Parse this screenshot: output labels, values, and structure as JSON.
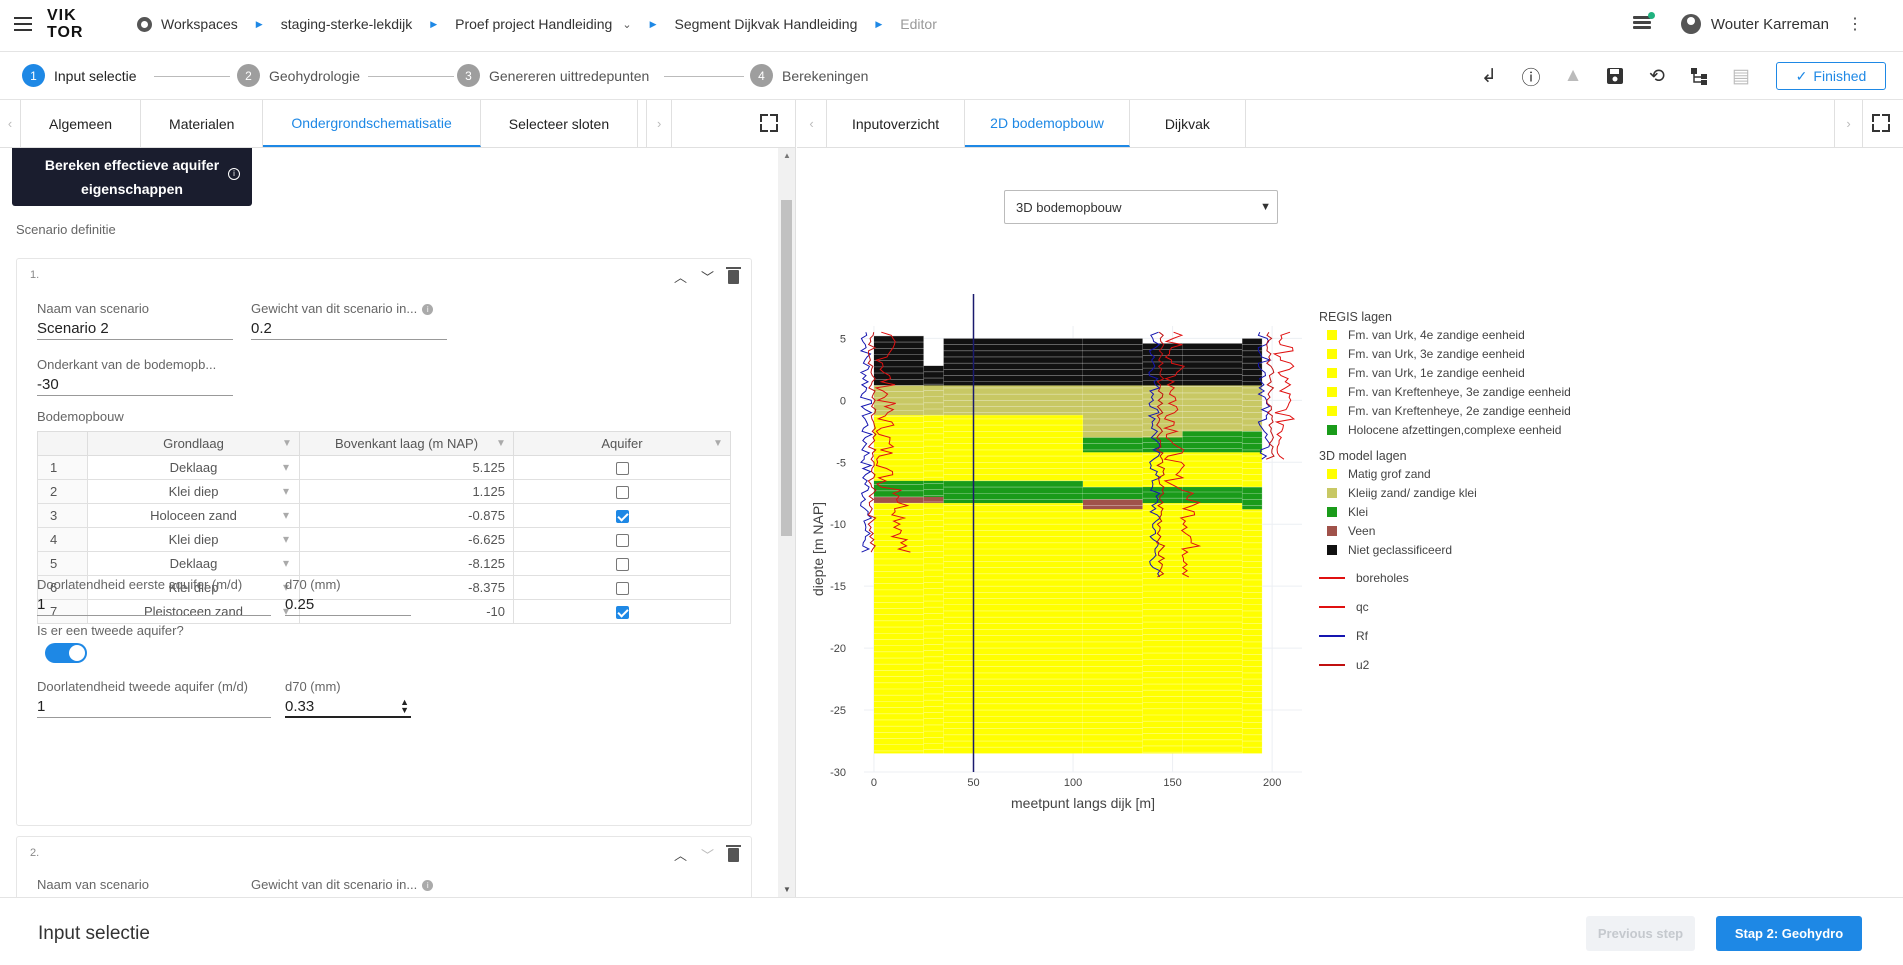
{
  "app": {
    "logo_top": "VIK",
    "logo_bottom": "TOR"
  },
  "breadcrumbs": [
    "Workspaces",
    "staging-sterke-lekdijk",
    "Proef project Handleiding",
    "Segment Dijkvak Handleiding",
    "Editor"
  ],
  "user": {
    "name": "Wouter Karreman"
  },
  "steps": [
    {
      "num": "1",
      "label": "Input selectie"
    },
    {
      "num": "2",
      "label": "Geohydrologie"
    },
    {
      "num": "3",
      "label": "Genereren uittredepunten"
    },
    {
      "num": "4",
      "label": "Berekeningen"
    }
  ],
  "toolbar": {
    "finished_label": "Finished"
  },
  "left_tabs": [
    "Algemeen",
    "Materialen",
    "Ondergrondschematisatie",
    "Selecteer sloten"
  ],
  "calc_button": {
    "line1": "Bereken effectieve aquifer",
    "line2": "eigenschappen"
  },
  "scenario_section": "Scenario definitie",
  "scenario1": {
    "num": "1.",
    "naam_label": "Naam van scenario",
    "naam_value": "Scenario 2",
    "gewicht_label": "Gewicht van dit scenario in...",
    "gewicht_value": "0.2",
    "onderkant_label": "Onderkant van de bodemopb...",
    "onderkant_value": "-30",
    "bodem_label": "Bodemopbouw",
    "table_headers": [
      "Grondlaag",
      "Bovenkant laag (m NAP)",
      "Aquifer"
    ],
    "rows": [
      {
        "idx": "1",
        "grondlaag": "Deklaag",
        "bovenkant": "5.125",
        "aquifer": false
      },
      {
        "idx": "2",
        "grondlaag": "Klei diep",
        "bovenkant": "1.125",
        "aquifer": false
      },
      {
        "idx": "3",
        "grondlaag": "Holoceen zand",
        "bovenkant": "-0.875",
        "aquifer": true
      },
      {
        "idx": "4",
        "grondlaag": "Klei diep",
        "bovenkant": "-6.625",
        "aquifer": false
      },
      {
        "idx": "5",
        "grondlaag": "Deklaag",
        "bovenkant": "-8.125",
        "aquifer": false
      },
      {
        "idx": "6",
        "grondlaag": "Klei diep",
        "bovenkant": "-8.375",
        "aquifer": false
      },
      {
        "idx": "7",
        "grondlaag": "Pleistoceen zand",
        "bovenkant": "-10",
        "aquifer": true
      }
    ],
    "doorl1_label": "Doorlatendheid eerste aquifer (m/d)",
    "doorl1_value": "1",
    "d70a_label": "d70 (mm)",
    "d70a_value": "0.25",
    "tweede_label": "Is er een tweede aquifer?",
    "tweede_value": true,
    "doorl2_label": "Doorlatendheid tweede aquifer (m/d)",
    "doorl2_value": "1",
    "d70b_label": "d70 (mm)",
    "d70b_value": "0.33"
  },
  "scenario2": {
    "num": "2.",
    "naam_label": "Naam van scenario",
    "gewicht_label": "Gewicht van dit scenario in..."
  },
  "right_tabs": [
    "Inputoverzicht",
    "2D bodemopbouw",
    "Dijkvak"
  ],
  "view_select": "3D bodemopbouw",
  "chart_data": {
    "type": "heatmap",
    "title": "",
    "xlabel": "meetpunt langs dijk [m]",
    "ylabel": "diepte [m NAP]",
    "xlim": [
      -5,
      215
    ],
    "ylim": [
      -30,
      6
    ],
    "xticks": [
      0,
      50,
      100,
      150,
      200
    ],
    "yticks": [
      5,
      0,
      -5,
      -10,
      -15,
      -20,
      -25,
      -30
    ],
    "vertical_marker_x": 50,
    "model_columns": [
      {
        "x0": 0,
        "x1": 25,
        "top": 5.2,
        "layers": [
          {
            "top": 5.2,
            "bottom": 1.2,
            "class": "Niet geclassificeerd"
          },
          {
            "top": 1.2,
            "bottom": -1.2,
            "class": "Kleiig zand/ zandige klei"
          },
          {
            "top": -1.2,
            "bottom": -6.5,
            "class": "Matig grof zand"
          },
          {
            "top": -6.5,
            "bottom": -7.8,
            "class": "Klei"
          },
          {
            "top": -7.8,
            "bottom": -8.3,
            "class": "Veen"
          },
          {
            "top": -8.3,
            "bottom": -28.5,
            "class": "Matig grof zand"
          }
        ]
      },
      {
        "x0": 25,
        "x1": 35,
        "top": 2.8,
        "layers": [
          {
            "top": 2.8,
            "bottom": 1.2,
            "class": "Niet geclassificeerd"
          },
          {
            "top": 1.2,
            "bottom": -1.2,
            "class": "Kleiig zand/ zandige klei"
          },
          {
            "top": -1.2,
            "bottom": -6.5,
            "class": "Matig grof zand"
          },
          {
            "top": -6.5,
            "bottom": -7.8,
            "class": "Klei"
          },
          {
            "top": -7.8,
            "bottom": -8.3,
            "class": "Veen"
          },
          {
            "top": -8.3,
            "bottom": -28.5,
            "class": "Matig grof zand"
          }
        ]
      },
      {
        "x0": 35,
        "x1": 105,
        "top": 5.0,
        "layers": [
          {
            "top": 5.0,
            "bottom": 1.2,
            "class": "Niet geclassificeerd"
          },
          {
            "top": 1.2,
            "bottom": -1.2,
            "class": "Kleiig zand/ zandige klei"
          },
          {
            "top": -1.2,
            "bottom": -6.5,
            "class": "Matig grof zand"
          },
          {
            "top": -6.5,
            "bottom": -8.3,
            "class": "Klei"
          },
          {
            "top": -8.3,
            "bottom": -28.5,
            "class": "Matig grof zand"
          }
        ]
      },
      {
        "x0": 105,
        "x1": 135,
        "top": 5.0,
        "layers": [
          {
            "top": 5.0,
            "bottom": 1.2,
            "class": "Niet geclassificeerd"
          },
          {
            "top": 1.2,
            "bottom": -3.0,
            "class": "Kleiig zand/ zandige klei"
          },
          {
            "top": -3.0,
            "bottom": -4.2,
            "class": "Klei"
          },
          {
            "top": -4.2,
            "bottom": -7.0,
            "class": "Matig grof zand"
          },
          {
            "top": -7.0,
            "bottom": -8.0,
            "class": "Klei"
          },
          {
            "top": -8.0,
            "bottom": -8.8,
            "class": "Veen"
          },
          {
            "top": -8.8,
            "bottom": -28.5,
            "class": "Matig grof zand"
          }
        ]
      },
      {
        "x0": 135,
        "x1": 155,
        "top": 4.6,
        "layers": [
          {
            "top": 4.6,
            "bottom": 1.2,
            "class": "Niet geclassificeerd"
          },
          {
            "top": 1.2,
            "bottom": -3.0,
            "class": "Kleiig zand/ zandige klei"
          },
          {
            "top": -3.0,
            "bottom": -4.2,
            "class": "Klei"
          },
          {
            "top": -4.2,
            "bottom": -7.0,
            "class": "Matig grof zand"
          },
          {
            "top": -7.0,
            "bottom": -8.3,
            "class": "Klei"
          },
          {
            "top": -8.3,
            "bottom": -28.5,
            "class": "Matig grof zand"
          }
        ]
      },
      {
        "x0": 155,
        "x1": 185,
        "top": 4.6,
        "layers": [
          {
            "top": 4.6,
            "bottom": 1.2,
            "class": "Niet geclassificeerd"
          },
          {
            "top": 1.2,
            "bottom": -2.5,
            "class": "Kleiig zand/ zandige klei"
          },
          {
            "top": -2.5,
            "bottom": -4.2,
            "class": "Klei"
          },
          {
            "top": -4.2,
            "bottom": -7.0,
            "class": "Matig grof zand"
          },
          {
            "top": -7.0,
            "bottom": -8.3,
            "class": "Klei"
          },
          {
            "top": -8.3,
            "bottom": -28.5,
            "class": "Matig grof zand"
          }
        ]
      },
      {
        "x0": 185,
        "x1": 195,
        "top": 5.0,
        "layers": [
          {
            "top": 5.0,
            "bottom": 1.2,
            "class": "Niet geclassificeerd"
          },
          {
            "top": 1.2,
            "bottom": -2.5,
            "class": "Kleiig zand/ zandige klei"
          },
          {
            "top": -2.5,
            "bottom": -4.2,
            "class": "Klei"
          },
          {
            "top": -4.2,
            "bottom": -7.0,
            "class": "Matig grof zand"
          },
          {
            "top": -7.0,
            "bottom": -8.8,
            "class": "Klei"
          },
          {
            "top": -8.8,
            "bottom": -28.5,
            "class": "Matig grof zand"
          }
        ]
      }
    ],
    "cpt_x": [
      0,
      145,
      200
    ],
    "legend_groups": [
      {
        "title": "REGIS lagen",
        "items": [
          {
            "label": "Fm. van Urk, 4e zandige eenheid",
            "color": "#ffff00"
          },
          {
            "label": "Fm. van Urk, 3e zandige eenheid",
            "color": "#ffff00"
          },
          {
            "label": "Fm. van Urk, 1e zandige eenheid",
            "color": "#ffff00"
          },
          {
            "label": "Fm. van Kreftenheye, 3e zandige eenheid",
            "color": "#ffff00"
          },
          {
            "label": "Fm. van Kreftenheye, 2e zandige eenheid",
            "color": "#ffff00"
          },
          {
            "label": "Holocene afzettingen,complexe eenheid",
            "color": "#1a9b1a"
          }
        ]
      },
      {
        "title": "3D model lagen",
        "items": [
          {
            "label": "Matig grof zand",
            "color": "#ffff00"
          },
          {
            "label": "Kleiig zand/ zandige klei",
            "color": "#c8c864"
          },
          {
            "label": "Klei",
            "color": "#1a9b1a"
          },
          {
            "label": "Veen",
            "color": "#a0524a"
          },
          {
            "label": "Niet geclassificeerd",
            "color": "#111111"
          }
        ]
      }
    ],
    "line_legend": [
      {
        "label": "boreholes",
        "color": "#e01010"
      },
      {
        "label": "qc",
        "color": "#e01010"
      },
      {
        "label": "Rf",
        "color": "#1515b0"
      },
      {
        "label": "u2",
        "color": "#c01010"
      }
    ],
    "class_colors": {
      "Matig grof zand": "#ffff00",
      "Kleiig zand/ zandige klei": "#c8c864",
      "Klei": "#1a9b1a",
      "Veen": "#a0524a",
      "Niet geclassificeerd": "#111111"
    }
  },
  "footer": {
    "title": "Input selectie",
    "prev_label": "Previous step",
    "next_label": "Stap 2: Geohydro"
  }
}
